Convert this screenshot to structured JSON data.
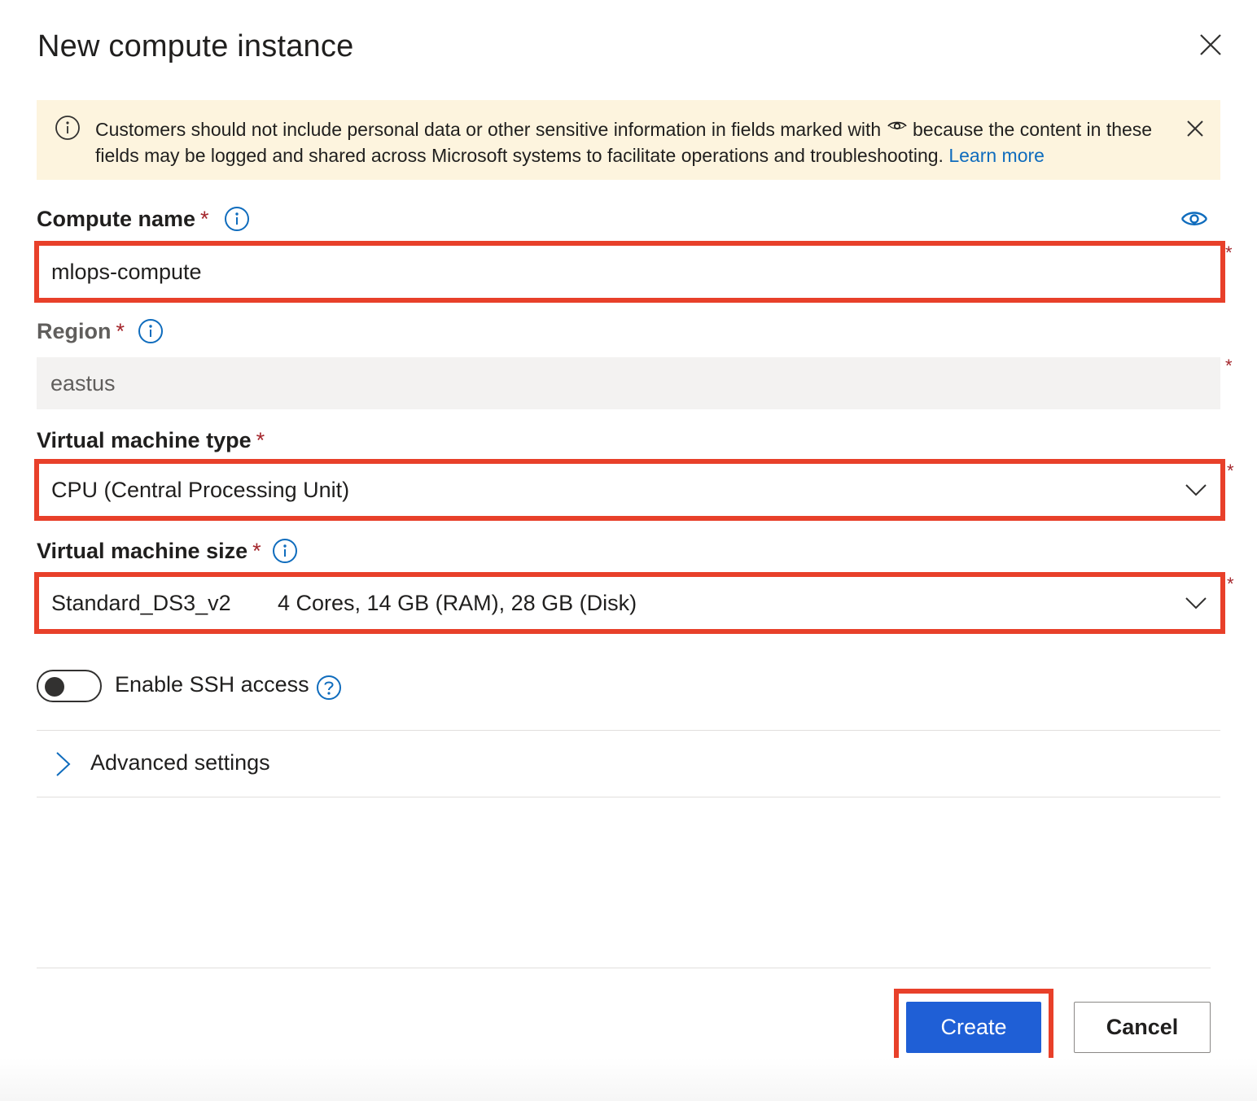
{
  "dialog": {
    "title": "New compute instance",
    "close_icon": "close-icon"
  },
  "banner": {
    "text_before": "Customers should not include personal data or other sensitive information in fields marked with",
    "text_after": "because the content in these fields may be logged and shared across Microsoft systems to facilitate operations and troubleshooting.",
    "link": "Learn more",
    "icons": [
      "info-icon",
      "eye-icon",
      "close-icon"
    ]
  },
  "form": {
    "compute_name": {
      "label": "Compute name",
      "required_mark": "*",
      "value": "mlops-compute",
      "side_mark": "*"
    },
    "region": {
      "label": "Region",
      "required_mark": "*",
      "value": "eastus",
      "side_mark": "*"
    },
    "vm_type": {
      "label": "Virtual machine type",
      "required_mark": "*",
      "value": "CPU (Central Processing Unit)",
      "side_mark": "*"
    },
    "vm_size": {
      "label": "Virtual machine size",
      "required_mark": "*",
      "value_name": "Standard_DS3_v2",
      "value_spec": "4 Cores, 14 GB (RAM), 28 GB (Disk)",
      "side_mark": "*"
    },
    "ssh": {
      "label": "Enable SSH access",
      "enabled": false
    },
    "advanced": {
      "label": "Advanced settings"
    }
  },
  "footer": {
    "create_label": "Create",
    "cancel_label": "Cancel"
  },
  "colors": {
    "accent": "#1f5fd6",
    "link": "#0f6cbd",
    "highlight": "#e8402a",
    "banner_bg": "#fdf4de",
    "required": "#a4262c"
  }
}
